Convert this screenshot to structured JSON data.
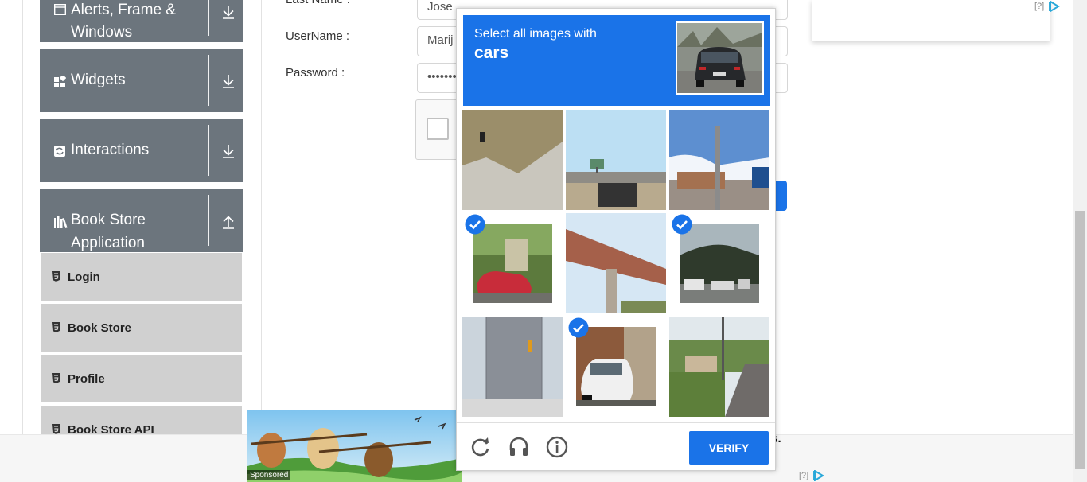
{
  "sidebar": {
    "groups": [
      {
        "label_line1": "Alerts, Frame &",
        "label_line2": "Windows",
        "icon": "window-icon",
        "arrow": "download-arrow-icon"
      },
      {
        "label": "Widgets",
        "icon": "widgets-icon",
        "arrow": "download-arrow-icon"
      },
      {
        "label": "Interactions",
        "icon": "interactions-icon",
        "arrow": "download-arrow-icon"
      },
      {
        "label_line1": "Book Store",
        "label_line2": "Application",
        "icon": "books-icon",
        "arrow": "upload-arrow-icon"
      }
    ],
    "items": [
      {
        "label": "Login",
        "icon": "html5-icon"
      },
      {
        "label": "Book Store",
        "icon": "html5-icon"
      },
      {
        "label": "Profile",
        "icon": "html5-icon"
      },
      {
        "label": "Book Store API",
        "icon": "html5-icon"
      }
    ]
  },
  "form": {
    "last_name_label": "Last Name :",
    "last_name_value": "Jose",
    "username_label": "UserName :",
    "username_value": "Marij",
    "password_label": "Password :",
    "password_value": "•••••••",
    "trailing_text": "os."
  },
  "captcha": {
    "instruction": "Select all images with",
    "target": "cars",
    "tiles": [
      {
        "selected": false
      },
      {
        "selected": false
      },
      {
        "selected": false
      },
      {
        "selected": true
      },
      {
        "selected": false
      },
      {
        "selected": true
      },
      {
        "selected": false
      },
      {
        "selected": true
      },
      {
        "selected": false
      }
    ],
    "verify_label": "VERIFY",
    "footer_icons": [
      "reload-icon",
      "audio-icon",
      "info-icon"
    ],
    "accent": "#1a73e8"
  },
  "ads": {
    "top_info": "[?]",
    "bottom_info": "[?]",
    "sponsored": "Sponsored"
  }
}
